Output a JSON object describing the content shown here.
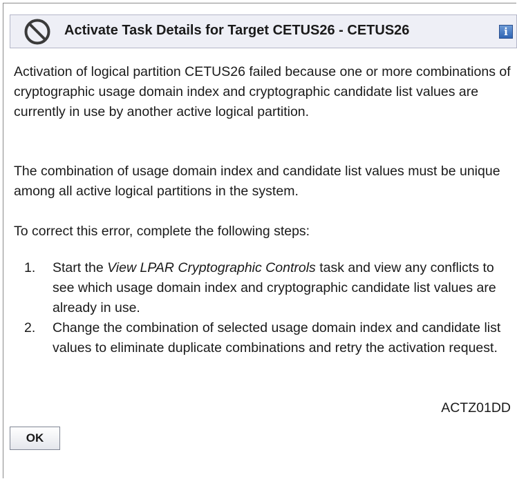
{
  "dialog": {
    "title": "Activate Task Details for Target CETUS26 - CETUS26",
    "status_icon": "prohibited-icon",
    "help_icon": "info-icon",
    "help_icon_glyph": "i"
  },
  "message": {
    "paragraph1": "Activation of logical partition CETUS26 failed because one or more combinations of cryptographic usage domain index and cryptographic candidate list values are currently in use by another active logical partition.",
    "paragraph2": "The combination of usage domain index and candidate list values must be unique among all active logical partitions in the system.",
    "paragraph3": "To correct this error, complete the following steps:",
    "steps": [
      {
        "number": "1.",
        "prefix": "Start the ",
        "emphasis": "View LPAR Cryptographic Controls",
        "suffix": " task and view any conflicts to see which usage domain index and cryptographic candidate list values are already in use."
      },
      {
        "number": "2.",
        "text": "Change the combination of selected usage domain index and candidate list values to eliminate duplicate combinations and retry the activation request."
      }
    ],
    "message_id": "ACTZ01DD"
  },
  "buttons": {
    "ok_label": "OK"
  }
}
